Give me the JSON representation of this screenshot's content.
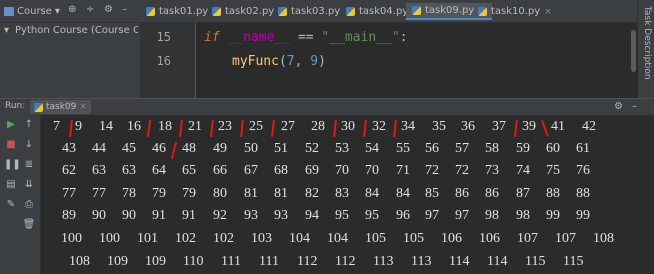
{
  "toolbar": {
    "project_button": "Course",
    "icons": [
      "dropdown-icon",
      "target-icon",
      "collapse-icon",
      "gear-icon",
      "minimize-icon"
    ]
  },
  "tabs": [
    {
      "label": "task01.py",
      "active": false
    },
    {
      "label": "task02.py",
      "active": false
    },
    {
      "label": "task03.py",
      "active": false
    },
    {
      "label": "task04.py",
      "active": false
    },
    {
      "label": "task09.py",
      "active": true
    },
    {
      "label": "task10.py",
      "active": false
    }
  ],
  "side_panel": {
    "label": "Task Description"
  },
  "project_tree": {
    "item": "Python Course (Course Creation)"
  },
  "editor": {
    "line_numbers": [
      "15",
      "16"
    ],
    "line15": {
      "kw": "if",
      "name": "__name__",
      "op": "==",
      "str": "\"__main__\"",
      "colon": ":"
    },
    "line16": {
      "fn": "myFunc",
      "open": "(",
      "a": "7",
      "comma": ", ",
      "b": "9",
      "close": ")"
    }
  },
  "run_panel": {
    "label": "Run:",
    "tab": "task09"
  },
  "accent": {
    "tab_underline": "#4a88c7",
    "annotation": "#e01818"
  },
  "output_rows": [
    [
      "7",
      "9",
      "14",
      "16",
      "18",
      "21",
      "23",
      "25",
      "27",
      "28",
      "30",
      "32",
      "34",
      "35",
      "36",
      "37",
      "39",
      "41",
      "42"
    ],
    [
      "43",
      "44",
      "45",
      "46",
      "48",
      "49",
      "50",
      "51",
      "52",
      "53",
      "54",
      "55",
      "56",
      "57",
      "58",
      "59",
      "60",
      "61"
    ],
    [
      "62",
      "63",
      "63",
      "64",
      "65",
      "66",
      "67",
      "68",
      "69",
      "70",
      "70",
      "71",
      "72",
      "72",
      "73",
      "74",
      "75",
      "76"
    ],
    [
      "77",
      "77",
      "78",
      "79",
      "79",
      "80",
      "81",
      "81",
      "82",
      "83",
      "84",
      "84",
      "85",
      "86",
      "86",
      "87",
      "88",
      "88"
    ],
    [
      "89",
      "90",
      "90",
      "91",
      "91",
      "92",
      "93",
      "93",
      "94",
      "95",
      "95",
      "96",
      "97",
      "97",
      "98",
      "98",
      "99",
      "99"
    ],
    [
      "100",
      "100",
      "101",
      "102",
      "102",
      "103",
      "104",
      "104",
      "105",
      "105",
      "106",
      "106",
      "107",
      "107",
      "108"
    ],
    [
      "108",
      "109",
      "109",
      "110",
      "111",
      "111",
      "112",
      "112",
      "113",
      "113",
      "114",
      "114",
      "115",
      "115"
    ]
  ]
}
